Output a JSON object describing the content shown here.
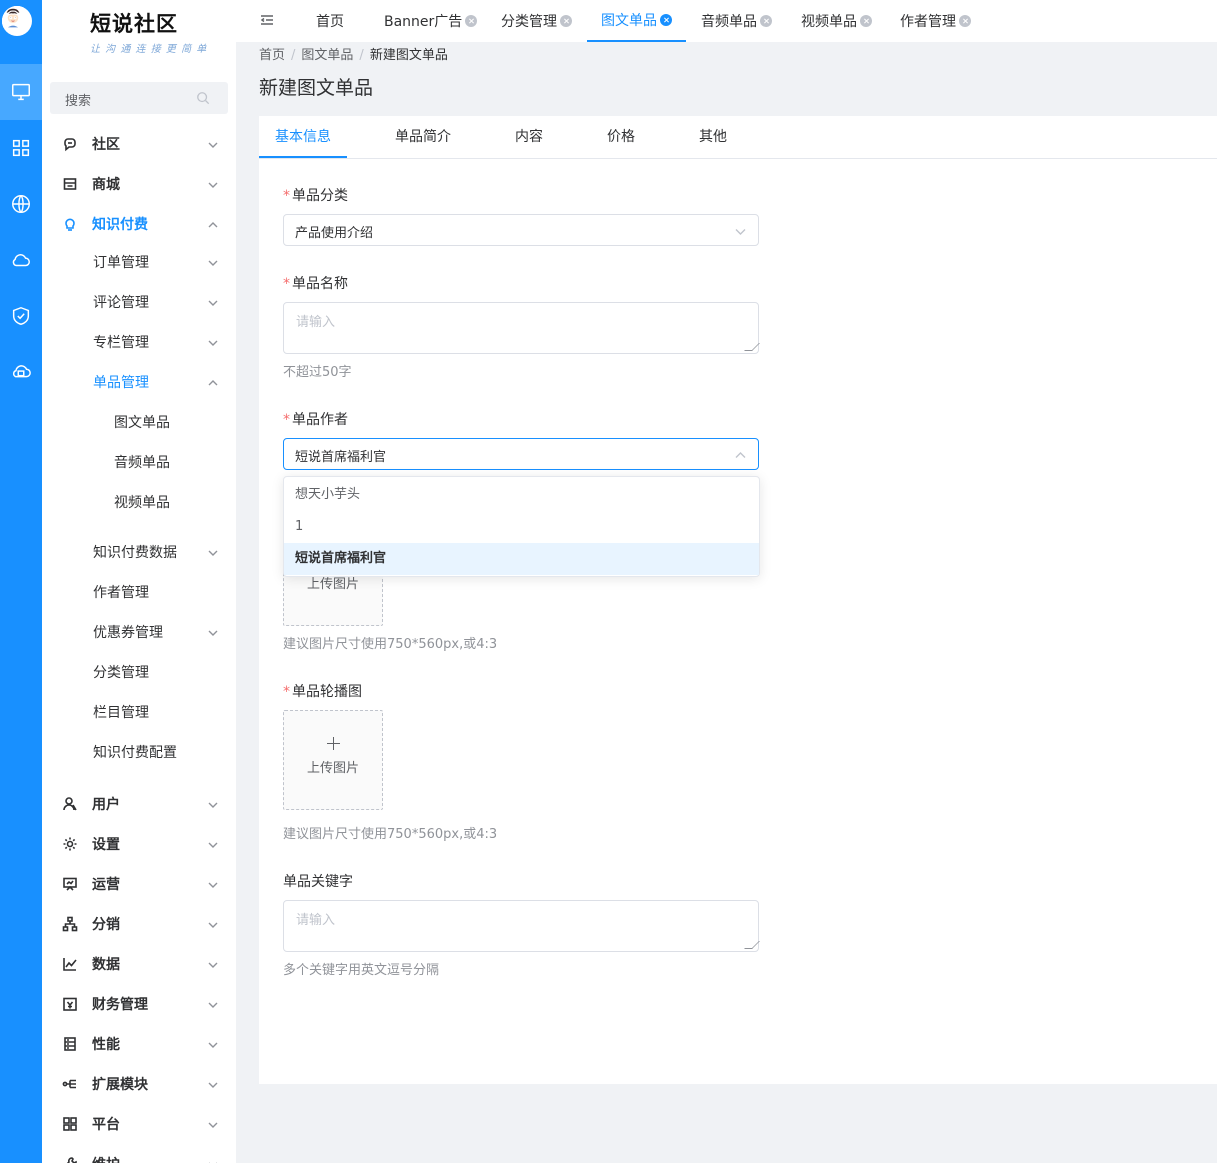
{
  "app": {
    "logo_title": "短说社区",
    "logo_sub": "让 沟 通 连 接 更 简 单",
    "search_placeholder": "搜索"
  },
  "rail": {
    "items": [
      "monitor-icon",
      "apps-icon",
      "globe-icon",
      "cloud-icon",
      "shield-check-icon",
      "cloud-server-icon"
    ]
  },
  "sidebar": {
    "items": [
      {
        "label": "社区",
        "icon": "chat-icon",
        "level": "top"
      },
      {
        "label": "商城",
        "icon": "shop-icon",
        "level": "top"
      },
      {
        "label": "知识付费",
        "icon": "bulb-icon",
        "level": "top",
        "active": true
      },
      {
        "label": "订单管理",
        "level": "sub"
      },
      {
        "label": "评论管理",
        "level": "sub"
      },
      {
        "label": "专栏管理",
        "level": "sub"
      },
      {
        "label": "单品管理",
        "level": "sub",
        "active": true
      },
      {
        "label": "图文单品",
        "level": "leaf"
      },
      {
        "label": "音频单品",
        "level": "leaf"
      },
      {
        "label": "视频单品",
        "level": "leaf"
      },
      {
        "label": "知识付费数据",
        "level": "sub"
      },
      {
        "label": "作者管理",
        "level": "sub"
      },
      {
        "label": "优惠券管理",
        "level": "sub"
      },
      {
        "label": "分类管理",
        "level": "sub"
      },
      {
        "label": "栏目管理",
        "level": "sub"
      },
      {
        "label": "知识付费配置",
        "level": "sub"
      },
      {
        "label": "用户",
        "icon": "user-icon",
        "level": "top"
      },
      {
        "label": "设置",
        "icon": "gear-icon",
        "level": "top"
      },
      {
        "label": "运营",
        "icon": "presentation-icon",
        "level": "top"
      },
      {
        "label": "分销",
        "icon": "hierarchy-icon",
        "level": "top"
      },
      {
        "label": "数据",
        "icon": "line-chart-icon",
        "level": "top"
      },
      {
        "label": "财务管理",
        "icon": "finance-icon",
        "level": "top"
      },
      {
        "label": "性能",
        "icon": "server-icon",
        "level": "top"
      },
      {
        "label": "扩展模块",
        "icon": "share-icon",
        "level": "top"
      },
      {
        "label": "平台",
        "icon": "grid-icon",
        "level": "top"
      },
      {
        "label": "维护",
        "icon": "tool-icon",
        "level": "top"
      }
    ]
  },
  "tabs": [
    {
      "label": "首页",
      "closable": false
    },
    {
      "label": "Banner广告",
      "closable": true
    },
    {
      "label": "分类管理",
      "closable": true
    },
    {
      "label": "图文单品",
      "closable": true,
      "active": true
    },
    {
      "label": "音频单品",
      "closable": true
    },
    {
      "label": "视频单品",
      "closable": true
    },
    {
      "label": "作者管理",
      "closable": true
    }
  ],
  "breadcrumb": [
    "首页",
    "图文单品",
    "新建图文单品"
  ],
  "breadcrumb_sep": "/",
  "page_title": "新建图文单品",
  "form_tabs": [
    "基本信息",
    "单品简介",
    "内容",
    "价格",
    "其他"
  ],
  "form": {
    "category": {
      "label": "单品分类",
      "required": true,
      "value": "产品使用介绍"
    },
    "name": {
      "label": "单品名称",
      "required": true,
      "placeholder": "请输入",
      "hint": "不超过50字"
    },
    "author": {
      "label": "单品作者",
      "required": true,
      "value": "短说首席福利官"
    },
    "cover": {
      "upload_label": "上传图片",
      "hint": "建议图片尺寸使用750*560px,或4:3"
    },
    "carousel": {
      "label": "单品轮播图",
      "required": true,
      "upload_label": "上传图片",
      "hint": "建议图片尺寸使用750*560px,或4:3"
    },
    "keywords": {
      "label": "单品关键字",
      "placeholder": "请输入",
      "hint": "多个关键字用英文逗号分隔"
    }
  },
  "author_options": [
    "想天小芋头",
    "1",
    "短说首席福利官"
  ],
  "colors": {
    "primary": "#1890ff",
    "required": "#f56c6c",
    "selected_bg": "#e8f4ff"
  }
}
